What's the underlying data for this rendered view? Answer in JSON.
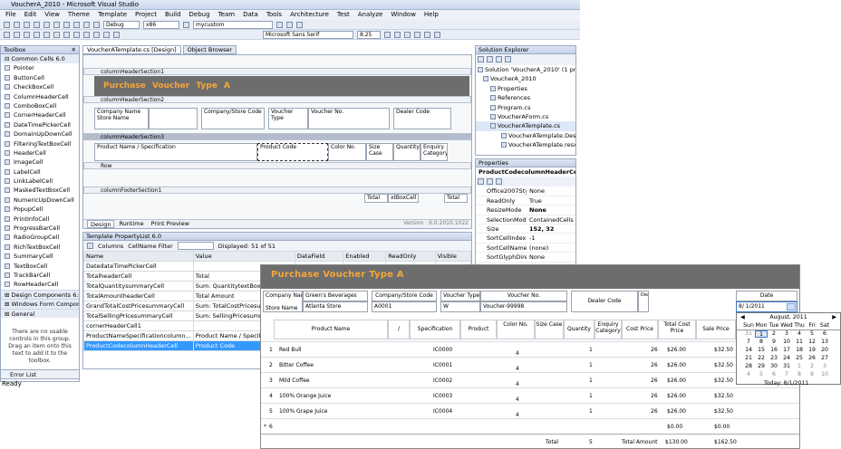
{
  "app": {
    "title": "VoucherA_2010 - Microsoft Visual Studio"
  },
  "menu": [
    "File",
    "Edit",
    "View",
    "Theme",
    "Template",
    "Project",
    "Build",
    "Debug",
    "Team",
    "Data",
    "Tools",
    "Architecture",
    "Test",
    "Analyze",
    "Window",
    "Help"
  ],
  "toolbar": {
    "config": "Debug",
    "platform": "x86",
    "target": "mycustom",
    "font": "Microsoft Sans Serif",
    "size": "8.25"
  },
  "toolbox": {
    "title": "Toolbox",
    "group": "Common Cells 6.0",
    "items": [
      "Pointer",
      "ButtonCell",
      "CheckBoxCell",
      "ColumnHeaderCell",
      "ComboBoxCell",
      "CornerHeaderCell",
      "DateTimePickerCell",
      "DomainUpDownCell",
      "FilteringTextBoxCell",
      "HeaderCell",
      "ImageCell",
      "LabelCell",
      "LinkLabelCell",
      "MaskedTextBoxCell",
      "NumericUpDownCell",
      "PopupCell",
      "PrintInfoCell",
      "ProgressBarCell",
      "RadioGroupCell",
      "RichTextBoxCell",
      "SummaryCell",
      "TextBoxCell",
      "TrackBarCell",
      "RowHeaderCell"
    ],
    "groups": [
      "Design Components 6.0",
      "Windows Form Compone...",
      "General"
    ],
    "empty_msg": "There are no usable controls in this group. Drag an item onto this text to add it to the toolbox.",
    "error_tab": "Error List",
    "status": "Ready"
  },
  "tabs": {
    "design": "VoucherATemplate.cs [Design]",
    "browser": "Object Browser"
  },
  "designer": {
    "s1": "columnHeaderSection1",
    "s2": "columnHeaderSection2",
    "s3": "columnHeaderSection3",
    "row": "Row",
    "footer": "columnFooterSection1",
    "title": "Purchase Voucher Type A",
    "company": "Company",
    "name": "Name",
    "store": "Store",
    "companystore": "Company/Store",
    "code": "Code",
    "voucher": "Voucher",
    "type": "Type",
    "no": "No.",
    "dealer": "Dealer",
    "product": "Product",
    "slash": "/",
    "spec": "Specification",
    "color": "Color No.",
    "size": "Size Case",
    "quantity": "Quantity",
    "enquiry": "Enquiry Category",
    "total": "Total",
    "tbcell": "xtBoxCell",
    "version": "Version : 6.0.2010.1022",
    "view_tabs": [
      "Design",
      "Runtime",
      "Print Preview"
    ]
  },
  "proplist": {
    "title": "Template PropertyList 6.0",
    "columns_label": "Columns",
    "filter_label": "CellName Filter",
    "displayed": "Displayed: 51 of 51",
    "headers": [
      "Name",
      "Value",
      "DataField",
      "Enabled",
      "ReadOnly",
      "Visible"
    ],
    "rows": [
      [
        "DatedateTimePickerCell",
        ""
      ],
      [
        "TotalheaderCell",
        "Total"
      ],
      [
        "TotalQuantitysummaryCell",
        "Sum: QuantitytextBoxCell"
      ],
      [
        "TotalAmountheaderCell",
        "Total Amount"
      ],
      [
        "GrandTotalCostPricesummaryCell",
        "Sum: TotalCostPricesummaryCell"
      ],
      [
        "TotalSellingPricesummaryCell",
        "Sum: SellingPricesummaryCell"
      ],
      [
        "cornerHeaderCell1",
        ""
      ],
      [
        "ProductNameSpecificationcolumn...",
        "Product Name / Specification"
      ],
      [
        "ProductCodecolumnHeaderCell",
        "Product Code"
      ]
    ]
  },
  "solution": {
    "title": "Solution Explorer",
    "items": [
      "Solution 'VoucherA_2010' (1 project)",
      "VoucherA_2010",
      "Properties",
      "References",
      "Program.cs",
      "VoucherAForm.cs",
      "VoucherATemplate.cs",
      "VoucherATemplate.Designer.cs",
      "VoucherATemplate.resx"
    ]
  },
  "properties": {
    "title": "Properties",
    "object": "ProductCodecolumnHeaderCell",
    "object_type": "Gra",
    "rows": [
      [
        "Office2007Style",
        "None"
      ],
      [
        "ReadOnly",
        "True"
      ],
      [
        "ResizeMode",
        "None"
      ],
      [
        "SelectionMode",
        "ContainedCells"
      ],
      [
        "Size",
        "152, 32"
      ],
      [
        "SortCellIndex",
        "-1"
      ],
      [
        "SortCellName",
        "(none)"
      ],
      [
        "SortGlyphDirec",
        "None"
      ]
    ]
  },
  "runtime": {
    "title": "Purchase Voucher Type A",
    "company_name": "Green's Beverages",
    "store_name": "Atlanta Store",
    "company_store_code": "A0001",
    "voucher_type": "W",
    "voucher_no": "Voucher-99998",
    "date_label": "Date",
    "date_value": "8/ 1/2011",
    "hdr_cost": "Cost",
    "hdr_price": "Price",
    "hdr_total_cost": "Total Cost Price",
    "hdr_sale": "Sale",
    "hdr_price2": "Price",
    "rows": [
      {
        "n": "1",
        "product": "Red Bull",
        "code": "IC0000",
        "color": "4",
        "qty": "1",
        "cost": "26",
        "total": "$26.00",
        "sale": "$32.50"
      },
      {
        "n": "2",
        "product": "Bitter Coffee",
        "code": "IC0001",
        "color": "4",
        "qty": "1",
        "cost": "26",
        "total": "$26.00",
        "sale": "$32.50"
      },
      {
        "n": "3",
        "product": "Mild Coffee",
        "code": "IC0002",
        "color": "4",
        "qty": "1",
        "cost": "26",
        "total": "$26.00",
        "sale": "$32.50"
      },
      {
        "n": "4",
        "product": "100% Orange Juice",
        "code": "IC0003",
        "color": "4",
        "qty": "1",
        "cost": "26",
        "total": "$26.00",
        "sale": "$32.50"
      },
      {
        "n": "5",
        "product": "100% Grape Juice",
        "code": "IC0004",
        "color": "4",
        "qty": "1",
        "cost": "26",
        "total": "$26.00",
        "sale": "$32.50"
      }
    ],
    "new_total": "$0.00",
    "new_sale": "$0.00",
    "new_marker": "*",
    "new_n": "6",
    "footer_total_label": "Total",
    "footer_qty": "5",
    "footer_amount_label": "Total Amount",
    "footer_cost": "$130.00",
    "footer_sale": "$162.50"
  },
  "calendar": {
    "month": "August, 2011",
    "days": [
      "Sun",
      "Mon",
      "Tue",
      "Wed",
      "Thu",
      "Fri",
      "Sat"
    ],
    "dates": [
      "31",
      "1",
      "2",
      "3",
      "4",
      "5",
      "6",
      "7",
      "8",
      "9",
      "10",
      "11",
      "12",
      "13",
      "14",
      "15",
      "16",
      "17",
      "18",
      "19",
      "20",
      "21",
      "22",
      "23",
      "24",
      "25",
      "26",
      "27",
      "28",
      "29",
      "30",
      "31",
      "1",
      "2",
      "3",
      "4",
      "5",
      "6",
      "7",
      "8",
      "9",
      "10"
    ],
    "today": "Today: 8/1/2011"
  }
}
